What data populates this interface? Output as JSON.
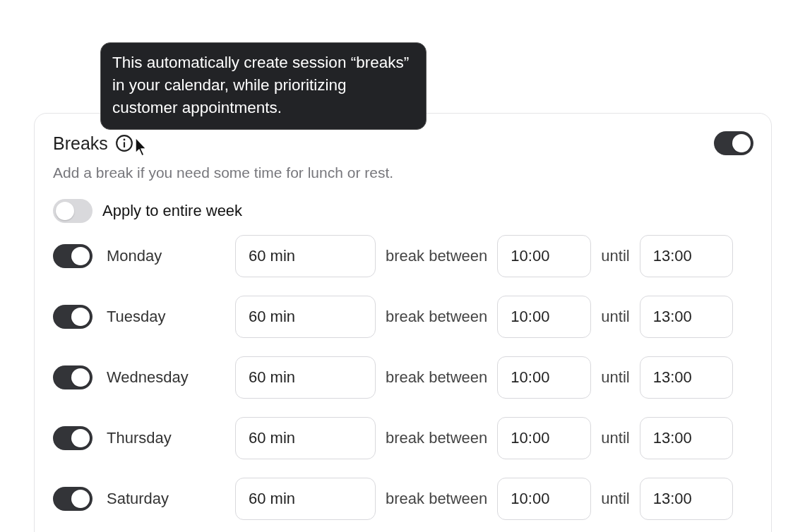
{
  "tooltip": {
    "text": "This automatically create session “breaks” in your calendar, while prioritizing customer appointments."
  },
  "card": {
    "title": "Breaks",
    "enabled": true,
    "description": "Add a break if you need some time for lunch or rest.",
    "apply_all": {
      "label": "Apply to entire week",
      "on": false
    },
    "days": [
      {
        "name": "Monday",
        "on": true,
        "duration": "60 min",
        "between_label": "break between",
        "start": "10:00",
        "until_label": "until",
        "end": "13:00"
      },
      {
        "name": "Tuesday",
        "on": true,
        "duration": "60 min",
        "between_label": "break between",
        "start": "10:00",
        "until_label": "until",
        "end": "13:00"
      },
      {
        "name": "Wednesday",
        "on": true,
        "duration": "60 min",
        "between_label": "break between",
        "start": "10:00",
        "until_label": "until",
        "end": "13:00"
      },
      {
        "name": "Thursday",
        "on": true,
        "duration": "60 min",
        "between_label": "break between",
        "start": "10:00",
        "until_label": "until",
        "end": "13:00"
      },
      {
        "name": "Saturday",
        "on": true,
        "duration": "60 min",
        "between_label": "break between",
        "start": "10:00",
        "until_label": "until",
        "end": "13:00"
      }
    ]
  }
}
